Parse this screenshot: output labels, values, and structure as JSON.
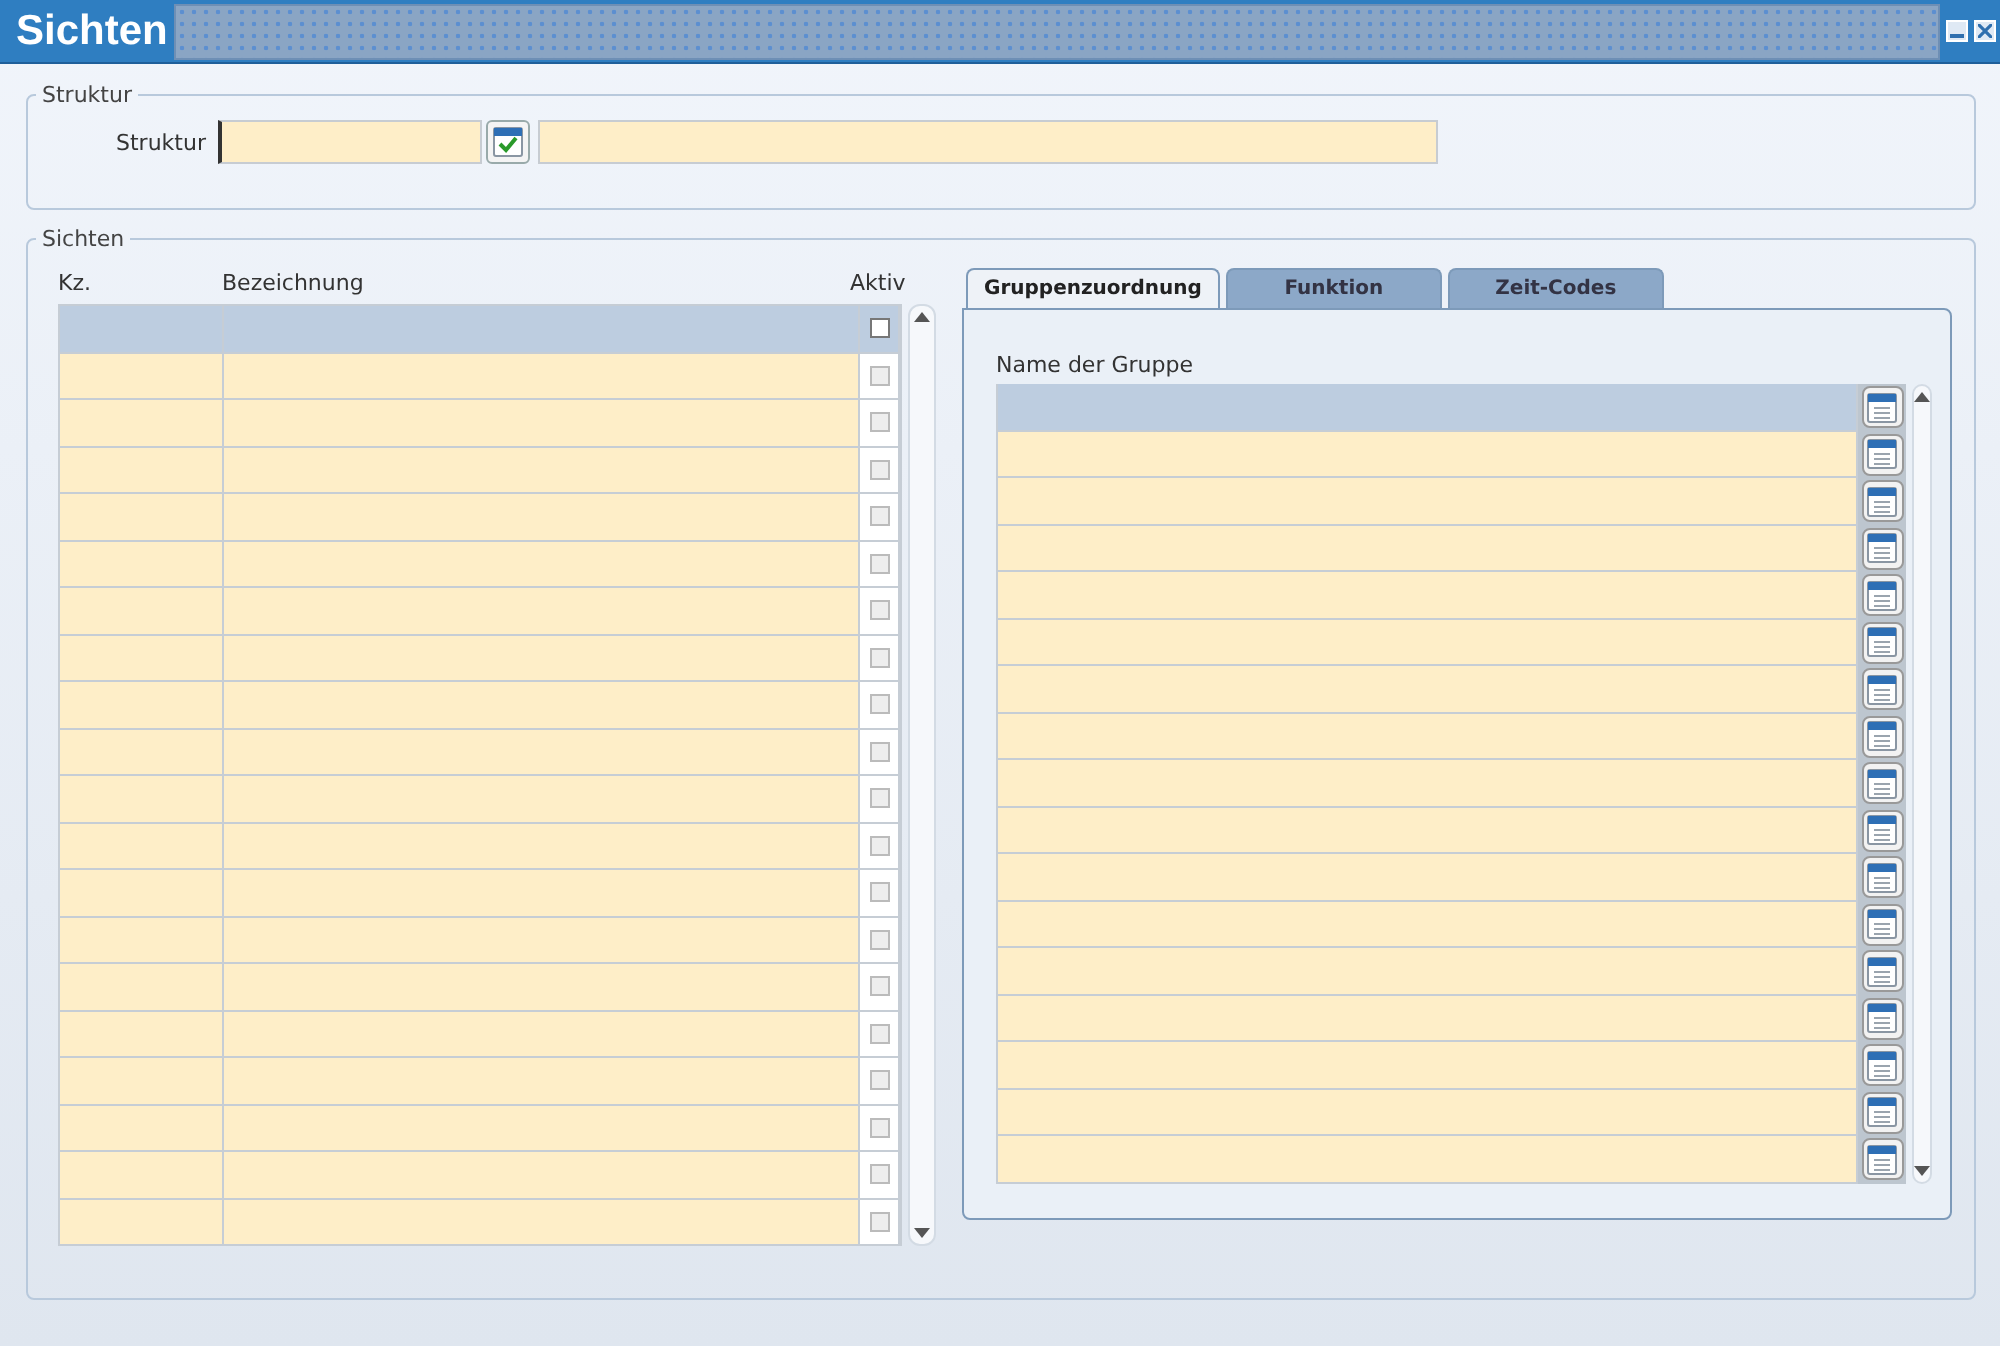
{
  "window": {
    "title": "Sichten"
  },
  "struktur_group": {
    "legend": "Struktur",
    "label": "Struktur"
  },
  "sichten_group": {
    "legend": "Sichten"
  },
  "views_table": {
    "columns": [
      "Kz.",
      "Bezeichnung",
      "Aktiv"
    ],
    "rows": [
      {
        "selected": true,
        "checked": false
      },
      {
        "selected": false,
        "checked": false
      },
      {
        "selected": false,
        "checked": false
      },
      {
        "selected": false,
        "checked": false
      },
      {
        "selected": false,
        "checked": false
      },
      {
        "selected": false,
        "checked": false
      },
      {
        "selected": false,
        "checked": false
      },
      {
        "selected": false,
        "checked": false
      },
      {
        "selected": false,
        "checked": false
      },
      {
        "selected": false,
        "checked": false
      },
      {
        "selected": false,
        "checked": false
      },
      {
        "selected": false,
        "checked": false
      },
      {
        "selected": false,
        "checked": false
      },
      {
        "selected": false,
        "checked": false
      },
      {
        "selected": false,
        "checked": false
      },
      {
        "selected": false,
        "checked": false
      },
      {
        "selected": false,
        "checked": false
      },
      {
        "selected": false,
        "checked": false
      },
      {
        "selected": false,
        "checked": false
      },
      {
        "selected": false,
        "checked": false
      }
    ]
  },
  "tabs": [
    {
      "label": "Gruppenzuordnung",
      "selected": true
    },
    {
      "label": "Funktion",
      "selected": false
    },
    {
      "label": "Zeit-Codes",
      "selected": false
    }
  ],
  "groups_table": {
    "column": "Name der Gruppe",
    "rows": [
      {
        "selected": true
      },
      {
        "selected": false
      },
      {
        "selected": false
      },
      {
        "selected": false
      },
      {
        "selected": false
      },
      {
        "selected": false
      },
      {
        "selected": false
      },
      {
        "selected": false
      },
      {
        "selected": false
      },
      {
        "selected": false
      },
      {
        "selected": false
      },
      {
        "selected": false
      },
      {
        "selected": false
      },
      {
        "selected": false
      },
      {
        "selected": false
      },
      {
        "selected": false
      },
      {
        "selected": false
      }
    ]
  }
}
